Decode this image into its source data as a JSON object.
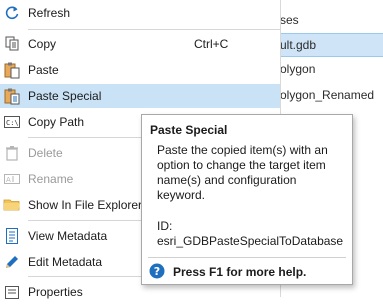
{
  "background_pane": {
    "items": [
      "ses",
      "ult.gdb",
      "olygon",
      "olygon_Renamed"
    ]
  },
  "menu": {
    "refresh": "Refresh",
    "copy": "Copy",
    "copy_shortcut": "Ctrl+C",
    "paste": "Paste",
    "paste_special": "Paste Special",
    "copy_path": "Copy Path",
    "delete": "Delete",
    "rename": "Rename",
    "show_in_explorer": "Show In File Explorer",
    "view_metadata": "View Metadata",
    "edit_metadata": "Edit Metadata",
    "properties": "Properties"
  },
  "tooltip": {
    "title": "Paste Special",
    "description": "Paste the copied item(s) with an option to change the target item name(s) and configuration keyword.",
    "id_label": "ID:",
    "id_value": "esri_GDBPasteSpecialToDatabase",
    "help": "Press F1 for more help."
  },
  "colors": {
    "hover": "#c9e2f6",
    "selection": "#cfe5f7",
    "accent_blue": "#1f6fbf"
  }
}
